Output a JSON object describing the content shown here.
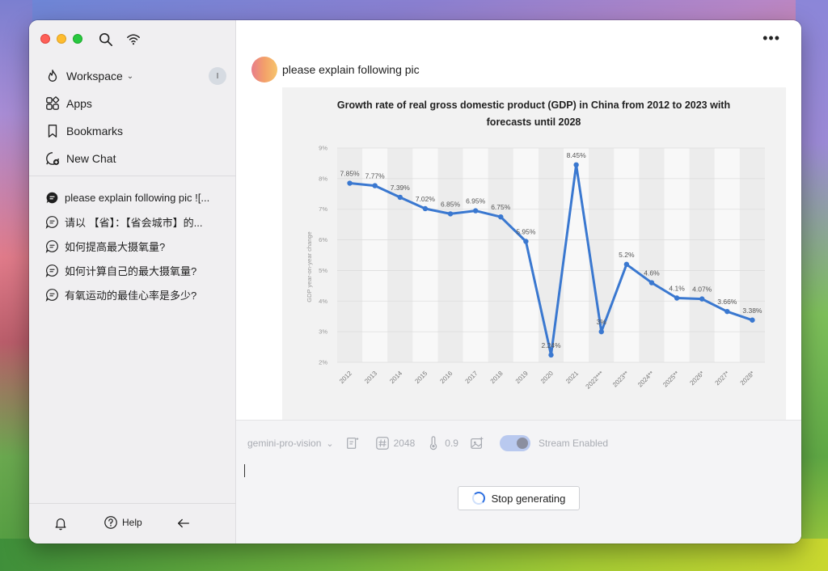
{
  "sidebar": {
    "workspace_label": "Workspace",
    "avatar_initial": "I",
    "nav": [
      {
        "label": "Apps",
        "icon": "apps-icon"
      },
      {
        "label": "Bookmarks",
        "icon": "bookmark-icon"
      },
      {
        "label": "New Chat",
        "icon": "new-chat-icon"
      }
    ],
    "chats": [
      {
        "title": "please explain following pic ![...",
        "active": true
      },
      {
        "title": "请以 【省】：【省会城市】的...",
        "active": false
      },
      {
        "title": "如何提高最大摄氧量?",
        "active": false
      },
      {
        "title": "如何计算自己的最大摄氧量?",
        "active": false
      },
      {
        "title": "有氧运动的最佳心率是多少?",
        "active": false
      }
    ],
    "help_label": "Help"
  },
  "message": {
    "text": "please explain following pic"
  },
  "chart_data": {
    "type": "line",
    "title_line1": "Growth rate of real gross domestic product (GDP) in China from 2012 to 2023 with",
    "title_line2": "forecasts until 2028",
    "ylabel": "GDP year-on-year change",
    "xlabel": "",
    "ylim": [
      2,
      9
    ],
    "y_ticks": [
      "2%",
      "3%",
      "4%",
      "5%",
      "6%",
      "7%",
      "8%",
      "9%"
    ],
    "categories": [
      "2012",
      "2013",
      "2014",
      "2015",
      "2016",
      "2017",
      "2018",
      "2019",
      "2020",
      "2021",
      "2022***",
      "2023**",
      "2024**",
      "2025**",
      "2026*",
      "2027*",
      "2028*"
    ],
    "values": [
      7.85,
      7.77,
      7.39,
      7.02,
      6.85,
      6.95,
      6.75,
      5.95,
      2.24,
      8.45,
      3.0,
      5.2,
      4.6,
      4.1,
      4.07,
      3.66,
      3.38
    ],
    "labels": [
      "7.85%",
      "7.77%",
      "7.39%",
      "7.02%",
      "6.85%",
      "6.95%",
      "6.75%",
      "5.95%",
      "2.24%",
      "8.45%",
      "3%",
      "5.2%",
      "4.6%",
      "4.1%",
      "4.07%",
      "3.66%",
      "3.38%"
    ],
    "line_color": "#3a78d0",
    "grid": true
  },
  "toolbar": {
    "model": "gemini-pro-vision",
    "max_tokens": "2048",
    "temperature": "0.9",
    "stream_label": "Stream Enabled"
  },
  "stop_button_label": "Stop generating"
}
